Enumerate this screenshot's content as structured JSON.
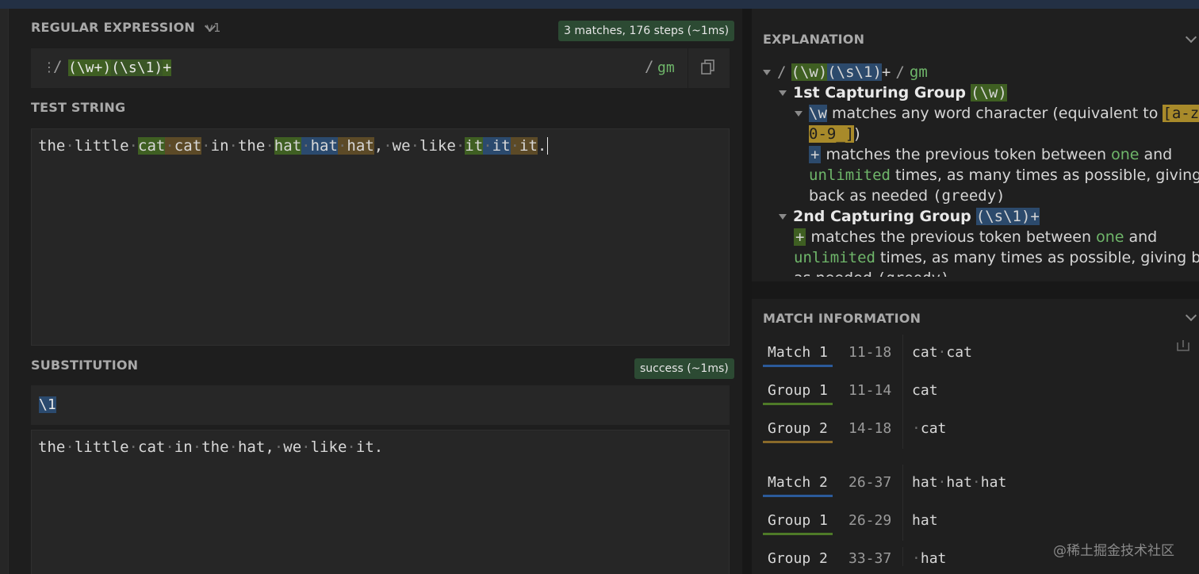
{
  "regex_section": {
    "title": "REGULAR EXPRESSION",
    "version": "v1",
    "status_badge": "3 matches, 176 steps (~1ms)",
    "delimiter_open": "/",
    "expression_parts": [
      "(\\w+)",
      "(\\s\\1)",
      "+"
    ],
    "delimiter_close": "/",
    "flags": "gm"
  },
  "test_section": {
    "title": "TEST STRING",
    "text": "the little cat cat in the hat hat hat, we like it it it."
  },
  "substitution_section": {
    "title": "SUBSTITUTION",
    "status_badge": "success (~1ms)",
    "expression": "\\1",
    "result": "the little cat in the hat, we like it."
  },
  "explanation": {
    "title": "EXPLANATION",
    "root_slash": "/",
    "root_parts": [
      "(\\w)",
      "(\\s\\1)",
      "+"
    ],
    "root_flag_slash": "/",
    "root_flags": "gm",
    "group1_title": "1st Capturing Group",
    "group1_token": "(\\w)",
    "w_token": "\\w",
    "w_desc": "matches any word character (equivalent to",
    "w_class_line1": "[a-zA-Z",
    "w_class_line2": "0-9_]",
    "w_close": ")",
    "plus_token": "+",
    "plus_desc_1": "matches the previous token between",
    "plus_one": "one",
    "plus_and": "and",
    "plus_unlimited": "unlimited",
    "plus_desc_2": "times, as many times as possible, giving",
    "plus_desc_3": "back as needed",
    "greedy": "(greedy)",
    "group2_title": "2nd Capturing Group",
    "group2_token": "(\\s\\1)+",
    "g2_plus_token": "+",
    "g2_desc_1": "matches the previous token between",
    "g2_one": "one",
    "g2_and": "and",
    "g2_unlimited": "unlimited",
    "g2_desc_2": "times, as many times as possible, giving back",
    "g2_desc_3": "as needed",
    "g2_greedy": "(greedy)"
  },
  "match_info": {
    "title": "MATCH INFORMATION",
    "rows": [
      {
        "label": "Match 1",
        "range": "11-18",
        "value": "cat·cat",
        "color": "#2b5a9a"
      },
      {
        "label": "Group 1",
        "range": "11-14",
        "value": "cat",
        "color": "#4e7a28"
      },
      {
        "label": "Group 2",
        "range": "14-18",
        "value": "·cat",
        "color": "#8a6a2a"
      },
      {
        "label": "Match 2",
        "range": "26-37",
        "value": "hat·hat·hat",
        "color": "#2b5a9a"
      },
      {
        "label": "Group 1",
        "range": "26-29",
        "value": "hat",
        "color": "#4e7a28"
      },
      {
        "label": "Group 2",
        "range": "33-37",
        "value": "·hat",
        "color": "#8a6a2a"
      }
    ]
  },
  "watermark": "@稀土掘金技术社区",
  "colors": {
    "accent_green": "#6fb66a",
    "badge_bg": "#2c4a33",
    "match_blue": "#2b5a9a"
  }
}
